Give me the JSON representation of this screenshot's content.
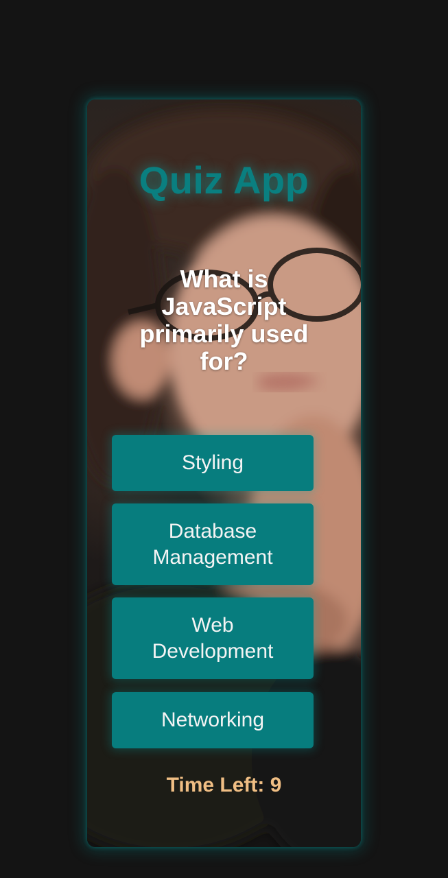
{
  "app": {
    "title": "Quiz App"
  },
  "question": {
    "text": "What is JavaScript primarily used for?"
  },
  "options": [
    {
      "label": "Styling"
    },
    {
      "label": "Database Management"
    },
    {
      "label": "Web Development"
    },
    {
      "label": "Networking"
    }
  ],
  "timer": {
    "label": "Time Left: 9"
  },
  "colors": {
    "page_background": "#141414",
    "accent_teal": "#077d7e",
    "title_teal": "#0a7f80",
    "timer_text": "#f0be84",
    "question_text": "#ffffff"
  }
}
